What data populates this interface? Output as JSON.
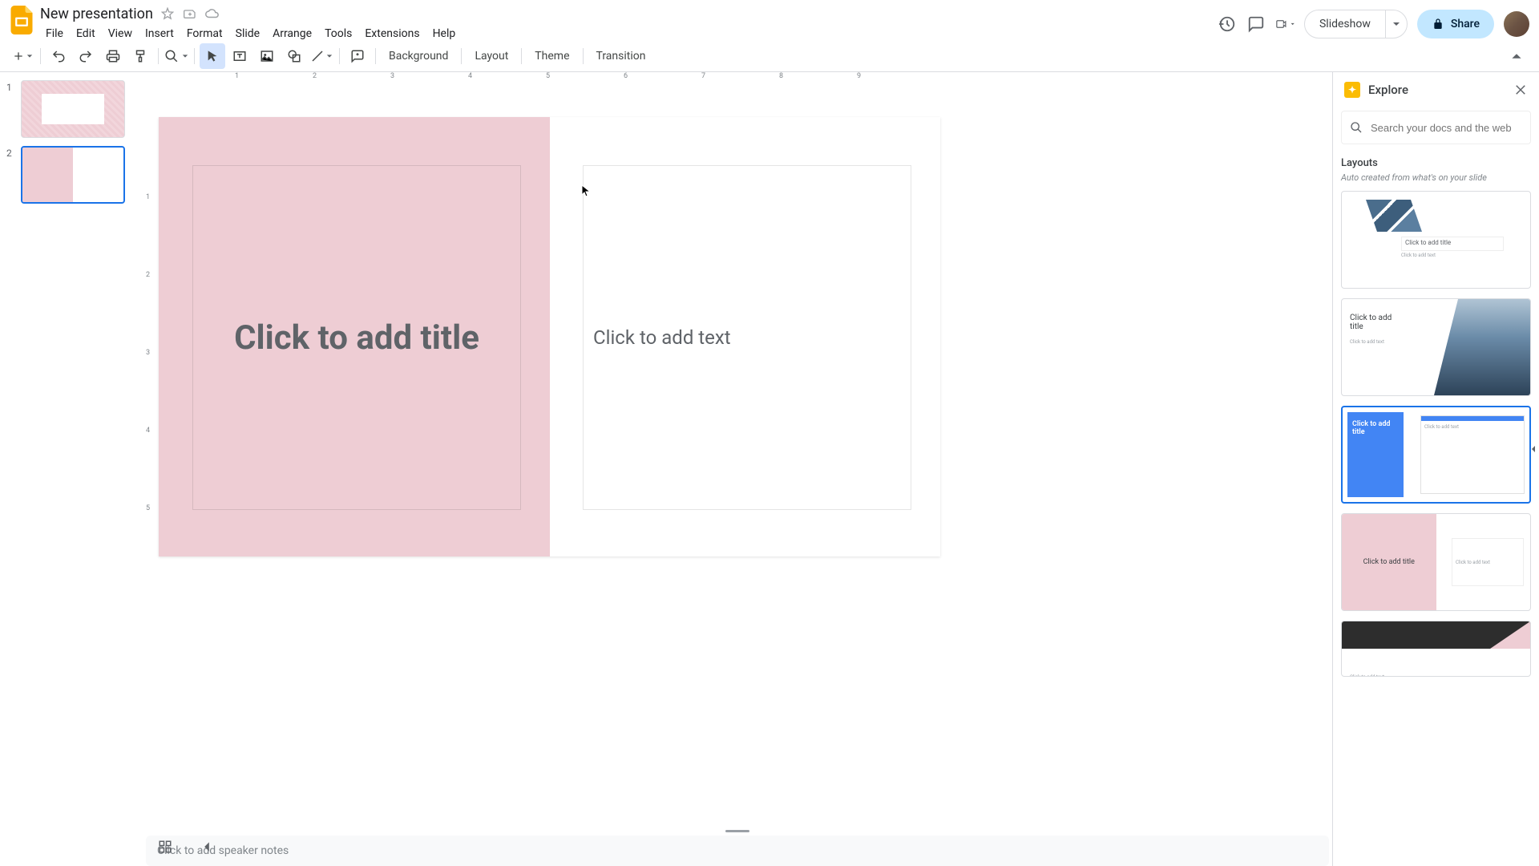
{
  "header": {
    "title": "New presentation",
    "menu": [
      "File",
      "Edit",
      "View",
      "Insert",
      "Format",
      "Slide",
      "Arrange",
      "Tools",
      "Extensions",
      "Help"
    ],
    "slideshow": "Slideshow",
    "share": "Share"
  },
  "toolbar": {
    "background": "Background",
    "layout": "Layout",
    "theme": "Theme",
    "transition": "Transition"
  },
  "filmstrip": {
    "slides": [
      {
        "num": "1"
      },
      {
        "num": "2"
      }
    ]
  },
  "ruler_h": [
    "1",
    "2",
    "3",
    "4",
    "5",
    "6",
    "7",
    "8",
    "9"
  ],
  "ruler_v": [
    "1",
    "2",
    "3",
    "4",
    "5"
  ],
  "slide": {
    "title_placeholder": "Click to add title",
    "body_placeholder": "Click to add text"
  },
  "notes": {
    "placeholder": "Click to add speaker notes"
  },
  "explore": {
    "title": "Explore",
    "search_placeholder": "Search your docs and the web",
    "layouts_title": "Layouts",
    "layouts_sub": "Auto created from what's on your slide",
    "card_title_ph": "Click to add title",
    "card_text_ph": "Click to add text"
  }
}
